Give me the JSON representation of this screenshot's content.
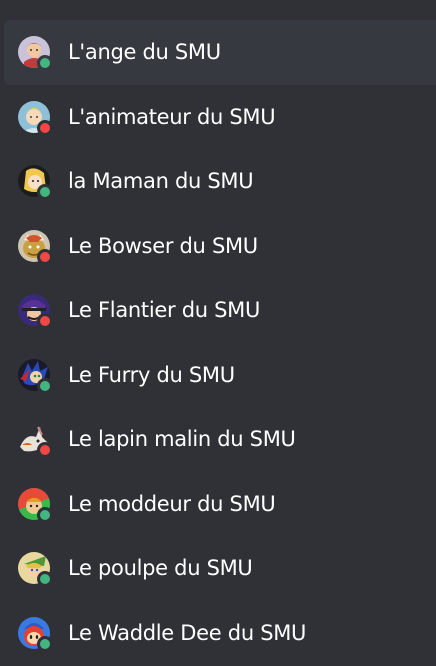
{
  "members": [
    {
      "name": "L'ange du SMU",
      "status": "online",
      "avatar": "ange-avatar",
      "hovered": true
    },
    {
      "name": "L'animateur du SMU",
      "status": "dnd",
      "avatar": "animateur-avatar",
      "hovered": false
    },
    {
      "name": "la Maman du SMU",
      "status": "online",
      "avatar": "maman-avatar",
      "hovered": false
    },
    {
      "name": "Le Bowser du SMU",
      "status": "dnd",
      "avatar": "bowser-avatar",
      "hovered": false
    },
    {
      "name": "Le Flantier du SMU",
      "status": "dnd",
      "avatar": "flantier-avatar",
      "hovered": false
    },
    {
      "name": "Le Furry du SMU",
      "status": "online",
      "avatar": "furry-avatar",
      "hovered": false
    },
    {
      "name": "Le lapin malin du SMU",
      "status": "dnd",
      "avatar": "lapin-avatar",
      "hovered": false
    },
    {
      "name": "Le moddeur du SMU",
      "status": "online",
      "avatar": "moddeur-avatar",
      "hovered": false
    },
    {
      "name": "Le poulpe du SMU",
      "status": "online",
      "avatar": "poulpe-avatar",
      "hovered": false
    },
    {
      "name": "Le Waddle Dee du SMU",
      "status": "online",
      "avatar": "waddle-dee-avatar",
      "hovered": false
    }
  ],
  "status_colors": {
    "online": "#43b581",
    "dnd": "#f04747"
  }
}
